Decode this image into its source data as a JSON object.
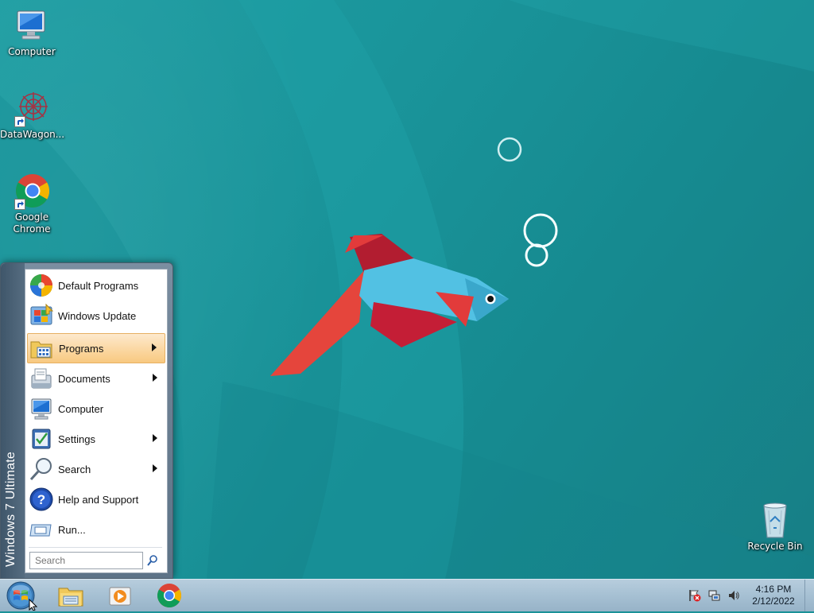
{
  "desktop": {
    "icons": {
      "computer": "Computer",
      "datawagon": "DataWagon...",
      "chrome": "Google Chrome",
      "recycle_bin": "Recycle Bin"
    }
  },
  "start_menu": {
    "edition_band": "Windows 7 Ultimate",
    "items": [
      {
        "label": "Default Programs",
        "icon": "default-programs-icon",
        "submenu": false
      },
      {
        "label": "Windows Update",
        "icon": "windows-update-icon",
        "submenu": false
      },
      {
        "label": "Programs",
        "icon": "programs-icon",
        "submenu": true,
        "highlighted": true
      },
      {
        "label": "Documents",
        "icon": "documents-icon",
        "submenu": true
      },
      {
        "label": "Computer",
        "icon": "computer-icon",
        "submenu": false
      },
      {
        "label": "Settings",
        "icon": "settings-icon",
        "submenu": true
      },
      {
        "label": "Search",
        "icon": "search-icon",
        "submenu": true
      },
      {
        "label": "Help and Support",
        "icon": "help-icon",
        "submenu": false
      },
      {
        "label": "Run...",
        "icon": "run-icon",
        "submenu": false
      }
    ],
    "search_placeholder": "Search"
  },
  "taskbar": {
    "pinned": [
      "start-orb-icon",
      "file-explorer-icon",
      "media-player-icon",
      "chrome-icon"
    ],
    "tray": [
      "action-center-flag-icon",
      "network-icon",
      "volume-icon"
    ],
    "clock": {
      "time": "4:16 PM",
      "date": "2/12/2022"
    }
  },
  "colors": {
    "wallpaper": "#1b9298",
    "menu_highlight": "#fbd9a6",
    "taskbar": "#a6c0d3"
  }
}
